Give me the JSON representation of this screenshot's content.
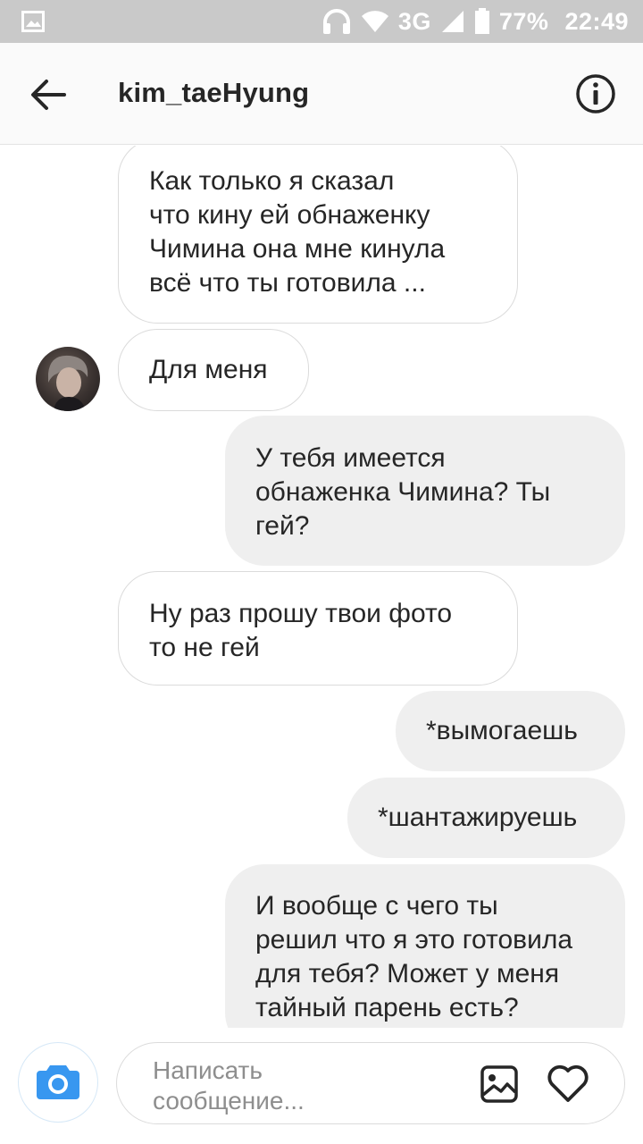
{
  "status_bar": {
    "network": "3G",
    "battery": "77%",
    "time": "22:49"
  },
  "header": {
    "title": "kim_taeHyung",
    "back_icon": "arrow-left-icon",
    "info_icon": "info-icon"
  },
  "messages": [
    {
      "direction": "in",
      "text": "Как только я сказал\nчто кину ей обнаженку\nЧимина она мне кинула\nвсё что ты готовила ..."
    },
    {
      "direction": "in",
      "text": "Для меня"
    },
    {
      "direction": "out",
      "text": "У тебя имеется\nобнаженка Чимина? Ты\nгей?"
    },
    {
      "direction": "in",
      "text": "Ну раз прошу твои фото\nто не гей"
    },
    {
      "direction": "out",
      "text": "*вымогаешь"
    },
    {
      "direction": "out",
      "text": "*шантажируешь"
    },
    {
      "direction": "out",
      "text": "И вообще с чего ты\nрешил что я это готовила\nдля тебя? Может у меня\nтайный парень есть?"
    }
  ],
  "composer": {
    "placeholder": "Написать\nсообщение...",
    "camera_icon": "camera-icon",
    "gallery_icon": "image-icon",
    "like_icon": "heart-icon"
  },
  "colors": {
    "accent": "#3897f0",
    "status_bar": "#c9c9c9",
    "incoming_bubble_border": "#dbdbdb",
    "outgoing_bubble": "#efefef"
  }
}
